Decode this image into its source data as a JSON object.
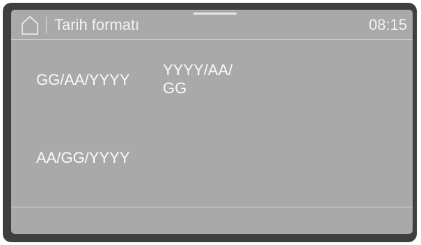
{
  "header": {
    "title": "Tarih formatı",
    "time": "08:15",
    "home_icon": "home-icon"
  },
  "options": [
    {
      "label": "GG/AA/YYYY"
    },
    {
      "label": "YYYY/AA/\nGG"
    },
    {
      "label": "AA/GG/YYYY"
    }
  ],
  "colors": {
    "bezel": "#3f3f3f",
    "screen": "#a9a9a9",
    "text": "#fafafa",
    "divider": "#d4d4d4"
  }
}
